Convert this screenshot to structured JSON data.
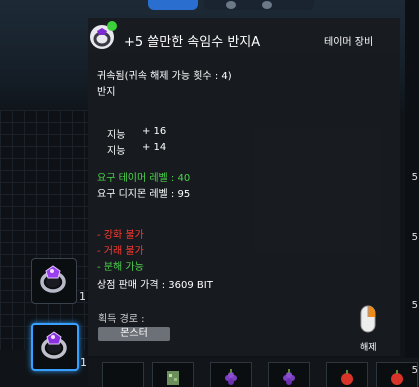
{
  "tooltip": {
    "title": "+5 쓸만한 속임수 반지A",
    "category": "테이머 장비",
    "bind_info": "귀속됨(귀속 해제 가능 횟수 : 4)",
    "item_type": "반지",
    "stats": [
      {
        "name": "지능",
        "value": "+ 16"
      },
      {
        "name": "지능",
        "value": "+ 14"
      }
    ],
    "req_tamer_level": "요구 테이머 레벨 : 40",
    "req_digimon_level": "요구 디지몬 레벨 : 95",
    "restrictions": [
      {
        "text": "- 강화 불가",
        "color": "#ff3b30"
      },
      {
        "text": "- 거래 불가",
        "color": "#ff3b30"
      },
      {
        "text": "- 분해 가능",
        "color": "#4cd44c"
      }
    ],
    "shop_price": "상점 판매 가격 : 3609 BIT",
    "acquire_label": "획득 경로 :",
    "acquire_source": "몬스터",
    "unequip_hint": "해제"
  },
  "inventory": {
    "slot_counts": [
      "1",
      "1"
    ]
  },
  "edge_numbers": [
    "5",
    "5",
    "5",
    "5"
  ],
  "colors": {
    "accent_green": "#4cd44c",
    "restriction_red": "#ff3b30",
    "selected_slot": "#3aa0ff"
  }
}
